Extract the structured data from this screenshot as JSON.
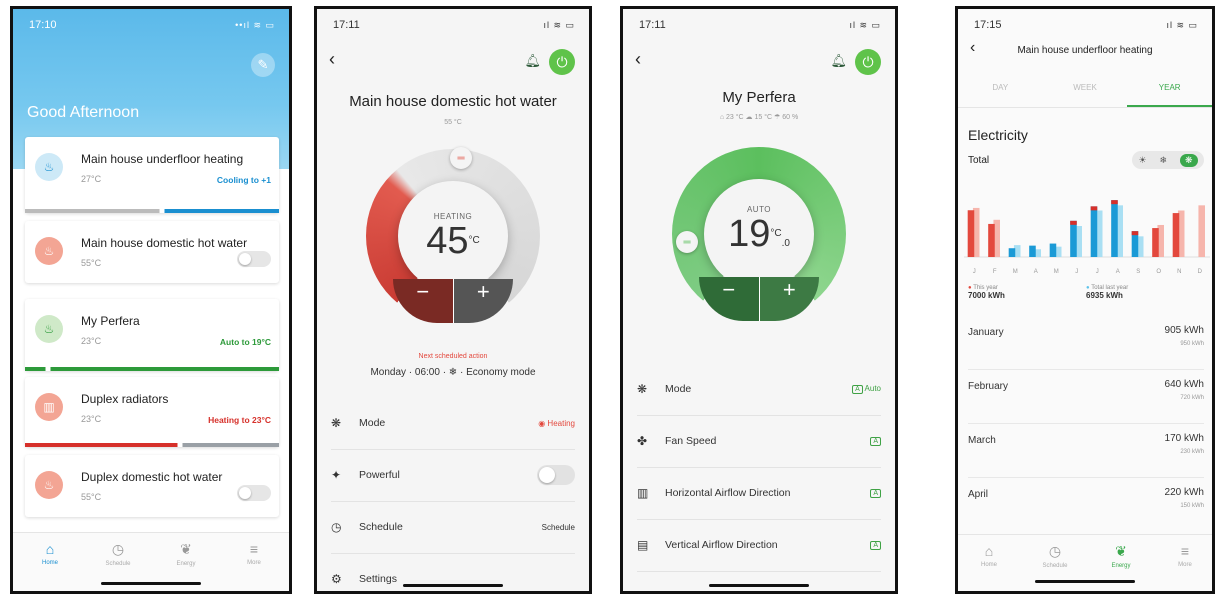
{
  "phone1": {
    "time": "17:10",
    "signal": "••ıl ≋ ▭",
    "greeting": "Good Afternoon",
    "edit_icon": "pencil-icon",
    "devices": [
      {
        "name": "Main house underfloor heating",
        "temp": "27°C",
        "status": "Cooling to +1",
        "status_color": "#1a8fd0",
        "icon_bg": "#cde9f7",
        "bar": "blue-split"
      },
      {
        "name": "Main house domestic hot water",
        "temp": "55°C",
        "icon_bg": "#f3a594",
        "toggle": "off"
      },
      {
        "name": "My Perfera",
        "temp": "23°C",
        "status": "Auto to 19°C",
        "status_color": "#2d9a3a",
        "icon_bg": "#cfe9c8",
        "bar": "green"
      },
      {
        "name": "Duplex radiators",
        "temp": "23°C",
        "status": "Heating to 23°C",
        "status_color": "#d6302a",
        "icon_bg": "#f3a594",
        "bar": "red-split"
      },
      {
        "name": "Duplex domestic hot water",
        "temp": "55°C",
        "icon_bg": "#f3a594",
        "toggle": "off"
      }
    ],
    "nav": [
      {
        "label": "Home",
        "icon": "home-icon"
      },
      {
        "label": "Schedule",
        "icon": "clock-icon"
      },
      {
        "label": "Energy",
        "icon": "leaf-icon"
      },
      {
        "label": "More",
        "icon": "menu-icon"
      }
    ]
  },
  "phone2": {
    "time": "17:11",
    "signal": "ıl ≋ ▭",
    "title": "Main house domestic hot water",
    "subtitle": "55 °C",
    "dial_mode": "HEATING",
    "dial_value": "45",
    "dial_unit": "°C",
    "minus": "−",
    "plus": "+",
    "next_label": "Next scheduled action",
    "next_value": "Monday · 06:00 · ❄ · Economy mode",
    "rows": [
      {
        "label": "Mode",
        "value": "Heating",
        "icon": "mode-icon"
      },
      {
        "label": "Powerful",
        "icon": "powerful-icon",
        "toggle": "off"
      },
      {
        "label": "Schedule",
        "value": "Schedule",
        "icon": "clock-icon"
      },
      {
        "label": "Settings",
        "icon": "gear-icon"
      }
    ],
    "accent": "#e3483d"
  },
  "phone3": {
    "time": "17:11",
    "signal": "ıl ≋ ▭",
    "title": "My Perfera",
    "subtitle": "⌂ 23 °C   ☁ 15 °C   ☂ 60 %",
    "dial_mode": "AUTO",
    "dial_value": "19",
    "dial_unit": "°C",
    "dial_decimal": ".0",
    "minus": "−",
    "plus": "+",
    "rows": [
      {
        "label": "Mode",
        "value": "Auto",
        "icon": "mode-icon"
      },
      {
        "label": "Fan Speed",
        "value": "A",
        "icon": "fan-icon"
      },
      {
        "label": "Horizontal Airflow Direction",
        "value": "A",
        "icon": "horizontal-airflow-icon"
      },
      {
        "label": "Vertical Airflow Direction",
        "value": "A",
        "icon": "vertical-airflow-icon"
      }
    ],
    "accent": "#5cbf5e"
  },
  "phone4": {
    "time": "17:15",
    "signal": "ıl ≋ ▭",
    "title": "Main house underfloor heating",
    "tabs": [
      "DAY",
      "WEEK",
      "YEAR"
    ],
    "active_tab": "YEAR",
    "section": "Electricity",
    "total_label": "Total",
    "chart_data": {
      "type": "bar",
      "categories": [
        "J",
        "F",
        "M",
        "A",
        "M",
        "J",
        "J",
        "A",
        "S",
        "O",
        "N",
        "D"
      ],
      "series": [
        {
          "name": "This year",
          "values": [
            905,
            640,
            170,
            220,
            260,
            700,
            980,
            1100,
            500,
            560,
            850,
            0
          ],
          "color_split": true
        },
        {
          "name": "Total last year",
          "values": [
            950,
            720,
            230,
            150,
            200,
            600,
            900,
            1000,
            400,
            620,
            900,
            1000
          ]
        }
      ]
    },
    "legend": [
      {
        "label": "This year",
        "value": "7000 kWh"
      },
      {
        "label": "Total last year",
        "value": "6935 kWh"
      }
    ],
    "months": [
      {
        "month": "January",
        "value": "905 kWh",
        "last": "950 kWh"
      },
      {
        "month": "February",
        "value": "640 kWh",
        "last": "720 kWh"
      },
      {
        "month": "March",
        "value": "170 kWh",
        "last": "230 kWh"
      },
      {
        "month": "April",
        "value": "220 kWh",
        "last": "150 kWh"
      }
    ],
    "nav": [
      {
        "label": "Home",
        "icon": "home-icon"
      },
      {
        "label": "Schedule",
        "icon": "clock-icon"
      },
      {
        "label": "Energy",
        "icon": "leaf-icon"
      },
      {
        "label": "More",
        "icon": "menu-icon"
      }
    ]
  }
}
